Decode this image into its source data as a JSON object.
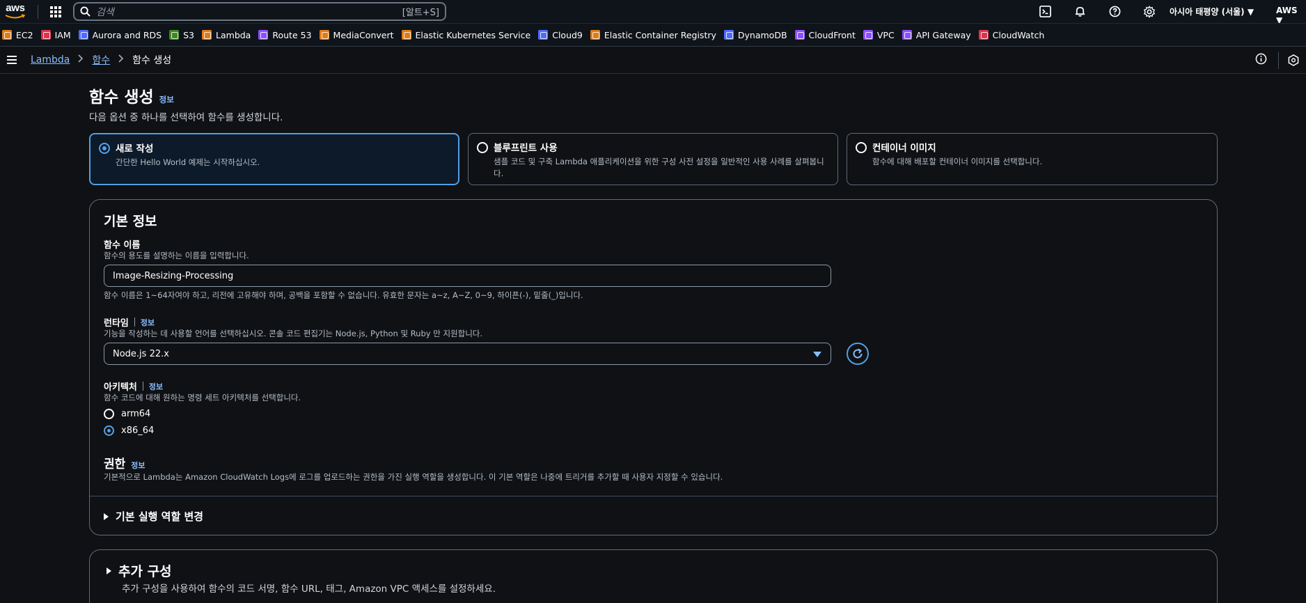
{
  "topnav": {
    "logo_text": "aws",
    "search_placeholder": "검색",
    "search_shortcut": "[알트+S]",
    "region": "아시아 태평양 (서울) ▼",
    "account": "AWS ▼"
  },
  "favorites": [
    {
      "label": "EC2",
      "color": "#e07b17"
    },
    {
      "label": "IAM",
      "color": "#dd344c"
    },
    {
      "label": "Aurora and RDS",
      "color": "#4d6bfe"
    },
    {
      "label": "S3",
      "color": "#3f8624"
    },
    {
      "label": "Lambda",
      "color": "#e07b17"
    },
    {
      "label": "Route 53",
      "color": "#8c4fff"
    },
    {
      "label": "MediaConvert",
      "color": "#e07b17"
    },
    {
      "label": "Elastic Kubernetes Service",
      "color": "#e07b17"
    },
    {
      "label": "Cloud9",
      "color": "#4d6bfe"
    },
    {
      "label": "Elastic Container Registry",
      "color": "#e07b17"
    },
    {
      "label": "DynamoDB",
      "color": "#4d6bfe"
    },
    {
      "label": "CloudFront",
      "color": "#8c4fff"
    },
    {
      "label": "VPC",
      "color": "#8c4fff"
    },
    {
      "label": "API Gateway",
      "color": "#8c4fff"
    },
    {
      "label": "CloudWatch",
      "color": "#dd344c"
    }
  ],
  "breadcrumb": {
    "root": "Lambda",
    "parent": "함수",
    "current": "함수 생성"
  },
  "page": {
    "title": "함수 생성",
    "title_info": "정보",
    "subtitle": "다음 옵션 중 하나를 선택하여 함수를 생성합니다."
  },
  "options": [
    {
      "title": "새로 작성",
      "desc": "간단한 Hello World 예제는 시작하십시오.",
      "selected": true
    },
    {
      "title": "블루프린트 사용",
      "desc": "샘플 코드 및 구축 Lambda 애플리케이션을 위한 구성 사전 설정을 일반적인 사용 사례를 살펴봅니다.",
      "selected": false
    },
    {
      "title": "컨테이너 이미지",
      "desc": "함수에 대해 배포할 컨테이너 이미지를 선택합니다.",
      "selected": false
    }
  ],
  "basic": {
    "title": "기본 정보",
    "fn_name_label": "함수 이름",
    "fn_name_desc": "함수의 용도를 설명하는 이름을 입력합니다.",
    "fn_name_value": "Image-Resizing-Processing",
    "fn_name_hint": "함수 이름은 1~64자여야 하고, 리전에 고유해야 하며, 공백을 포함할 수 없습니다. 유효한 문자는 a~z, A~Z, 0~9, 하이픈(-), 밑줄(_)입니다.",
    "runtime_label": "런타임",
    "runtime_info": "정보",
    "runtime_desc": "기능을 작성하는 데 사용할 언어를 선택하십시오. 콘솔 코드 편집기는 Node.js, Python 및 Ruby 만 지원합니다.",
    "runtime_value": "Node.js 22.x",
    "arch_label": "아키텍처",
    "arch_info": "정보",
    "arch_desc": "함수 코드에 대해 원하는 명령 세트 아키텍처를 선택합니다.",
    "arch_options": [
      "arm64",
      "x86_64"
    ],
    "arch_selected": "x86_64",
    "perm_title": "권한",
    "perm_info": "정보",
    "perm_desc": "기본적으로 Lambda는 Amazon CloudWatch Logs에 로그를 업로드하는 권한을 가진 실행 역할을 생성합니다. 이 기본 역할은 나중에 트리거를 추가할 때 사용자 지정할 수 있습니다.",
    "role_expander": "기본 실행 역할 변경"
  },
  "additional": {
    "title": "추가 구성",
    "desc": "추가 구성을 사용하여 함수의 코드 서명, 함수 URL, 태그, Amazon VPC 액세스를 설정하세요."
  }
}
